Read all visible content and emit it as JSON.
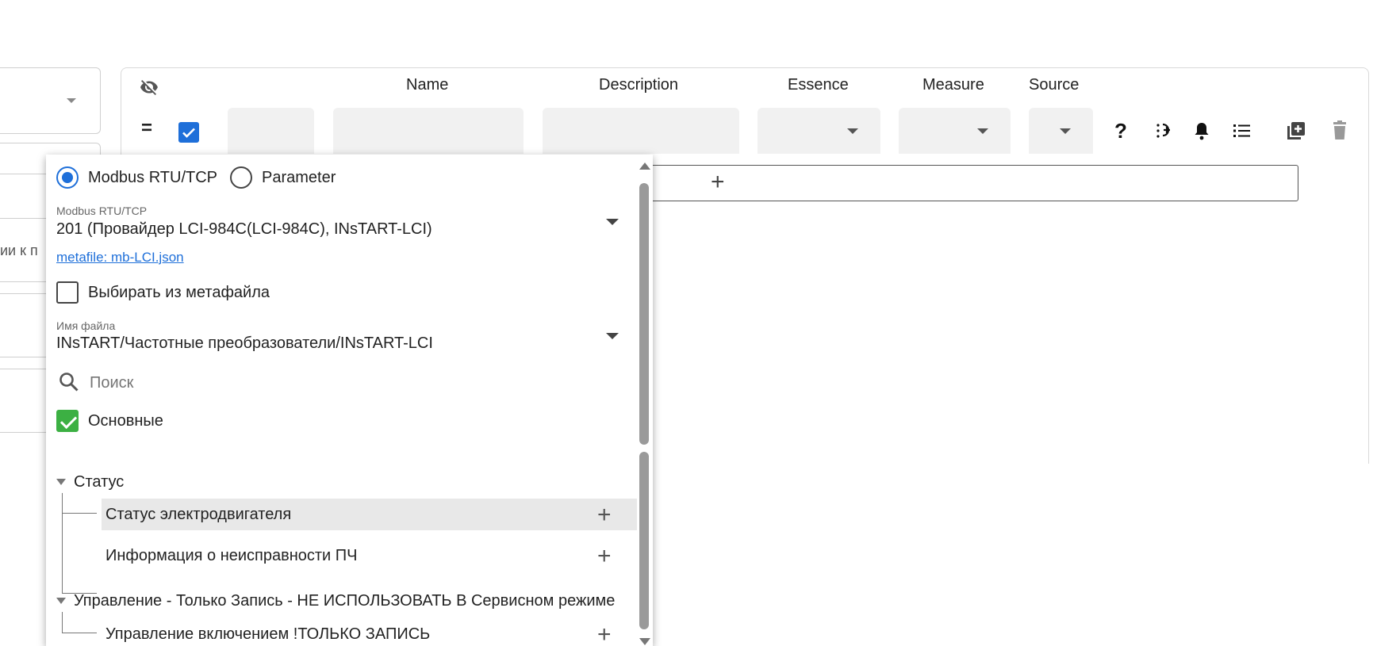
{
  "background_form": {
    "truncated_text": "ии к п"
  },
  "table": {
    "headers": {
      "name": "Name",
      "description": "Description",
      "essence": "Essence",
      "measure": "Measure",
      "source": "Source"
    },
    "row_handle": "=",
    "row_checked": true,
    "tool_icons": [
      "help-icon",
      "touch-add-icon",
      "bell-icon",
      "list-icon",
      "library-add-icon",
      "delete-icon"
    ],
    "help_glyph": "?",
    "add_row_symbol": "+"
  },
  "popup": {
    "source_options": [
      {
        "label": "Modbus RTU/TCP",
        "selected": true
      },
      {
        "label": "Parameter",
        "selected": false
      }
    ],
    "device_field": {
      "label": "Modbus RTU/TCP",
      "value": "201 (Провайдер LCI-984C(LCI-984C), INsTART-LCI)"
    },
    "metafile_link": "metafile: mb-LCI.json",
    "select_from_metafile": {
      "label": "Выбирать из метафайла",
      "checked": false
    },
    "file_field": {
      "label": "Имя файла",
      "value": "INsTART/Частотные преобразователи/INsTART-LCI"
    },
    "search": {
      "placeholder": "Поиск"
    },
    "main_group": {
      "label": "Основные",
      "checked": true
    },
    "tree": [
      {
        "label": "Статус",
        "children": [
          "Статус электродвигателя",
          "Информация о неисправности ПЧ"
        ]
      },
      {
        "label": "Управление - Только Запись - НЕ ИСПОЛЬЗОВАТЬ В Сервисном режиме",
        "children": [
          "Управление включением !ТОЛЬКО ЗАПИСЬ"
        ]
      }
    ],
    "add_symbol": "+"
  },
  "colors": {
    "accent": "#1e6fd9",
    "check_green": "#3cb043",
    "highlight_row": "#e8e8e8"
  }
}
